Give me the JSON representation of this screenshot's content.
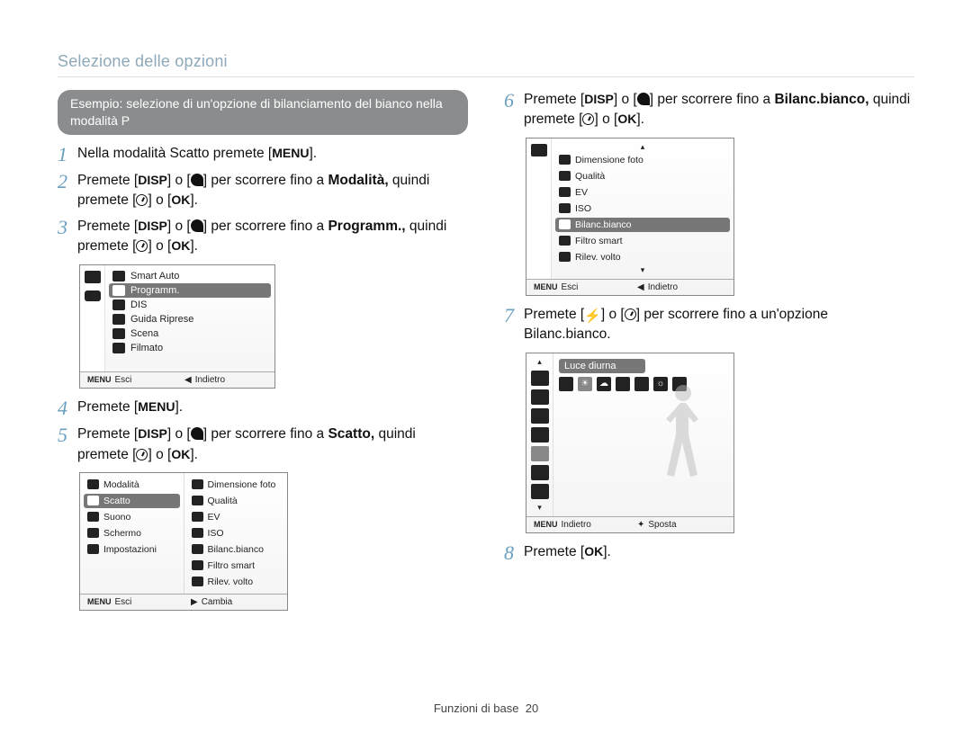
{
  "header": "Selezione delle opzioni",
  "pill": "Esempio: selezione di un'opzione di bilanciamento del bianco nella modalità P",
  "buttons": {
    "menu": "MENU",
    "disp": "DISP",
    "ok": "OK"
  },
  "steps": {
    "s1_a": "Nella modalità Scatto premete [",
    "s1_b": "].",
    "s2_a": "Premete [",
    "s2_b": "] o [",
    "s2_c": "] per scorrere fino a ",
    "s2_bold": "Modalità,",
    "s2_d": " quindi premete [",
    "s2_e": "] o [",
    "s2_f": "].",
    "s3_a": "Premete [",
    "s3_b": "] o [",
    "s3_c": "] per scorrere fino a ",
    "s3_bold": "Programm.,",
    "s3_d": " quindi premete [",
    "s3_e": "] o [",
    "s3_f": "].",
    "s4_a": "Premete [",
    "s4_b": "].",
    "s5_a": "Premete [",
    "s5_b": "] o [",
    "s5_c": "] per scorrere fino a ",
    "s5_bold": "Scatto,",
    "s5_d": " quindi premete [",
    "s5_e": "] o [",
    "s5_f": "].",
    "s6_a": "Premete [",
    "s6_b": "] o [",
    "s6_c": "] per scorrere fino a ",
    "s6_bold": "Bilanc.bianco,",
    "s6_d": " quindi premete [",
    "s6_e": "] o [",
    "s6_f": "].",
    "s7_a": "Premete [",
    "s7_b": "] o [",
    "s7_c": "] per scorrere fino a un'opzione Bilanc.bianco.",
    "s8_a": "Premete [",
    "s8_b": "]."
  },
  "screen1": {
    "items": [
      "Smart Auto",
      "Programm.",
      "DIS",
      "Guida Riprese",
      "Scena",
      "Filmato"
    ],
    "foot_left": "Esci",
    "foot_right": "Indietro"
  },
  "screen2": {
    "left": [
      "Modalità",
      "Scatto",
      "Suono",
      "Schermo",
      "Impostazioni"
    ],
    "right": [
      "Dimensione foto",
      "Qualità",
      "EV",
      "ISO",
      "Bilanc.bianco",
      "Filtro smart",
      "Rilev. volto"
    ],
    "foot_left": "Esci",
    "foot_right": "Cambia"
  },
  "screen3": {
    "right": [
      "Dimensione foto",
      "Qualità",
      "EV",
      "ISO",
      "Bilanc.bianco",
      "Filtro smart",
      "Rilev. volto"
    ],
    "foot_left": "Esci",
    "foot_right": "Indietro"
  },
  "screen4": {
    "label": "Luce diurna",
    "foot_left": "Indietro",
    "foot_right": "Sposta"
  },
  "footer_label": "Funzioni di base",
  "footer_page": "20"
}
